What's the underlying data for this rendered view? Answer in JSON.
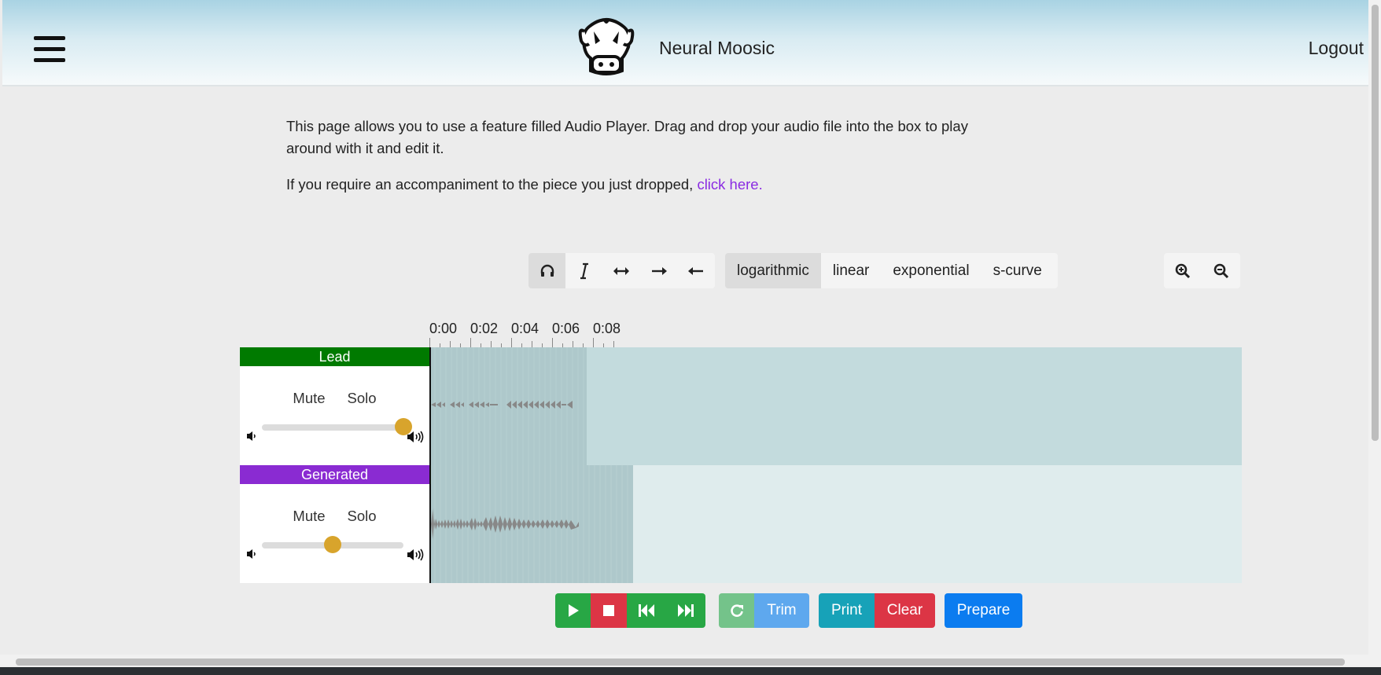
{
  "header": {
    "brand": "Neural Moosic",
    "logout": "Logout"
  },
  "intro": {
    "text": "This page allows you to use a feature filled Audio Player. Drag and drop your audio file into the box to play around with it and edit it.",
    "accompaniment_prefix": "If you require an accompaniment to the piece you just dropped, ",
    "accompaniment_link": "click here."
  },
  "toolbar": {
    "modes": [
      {
        "name": "headphones-icon",
        "active": true
      },
      {
        "name": "cursor-icon",
        "active": false
      },
      {
        "name": "shift-icon",
        "active": false
      },
      {
        "name": "fade-in-icon",
        "active": false
      },
      {
        "name": "fade-out-icon",
        "active": false
      }
    ],
    "fade_types": [
      "logarithmic",
      "linear",
      "exponential",
      "s-curve"
    ],
    "selected_fade": "logarithmic",
    "zoom": [
      "zoom-in-icon",
      "zoom-out-icon"
    ]
  },
  "timeline": {
    "labels": [
      "0:00",
      "0:02",
      "0:04",
      "0:06",
      "0:08"
    ]
  },
  "tracks": [
    {
      "name": "Lead",
      "color": "#007a00",
      "mute": "Mute",
      "solo": "Solo",
      "volume": 1.0
    },
    {
      "name": "Generated",
      "color": "#8a2bd2",
      "mute": "Mute",
      "solo": "Solo",
      "volume": 0.5
    }
  ],
  "transport": {
    "trim": "Trim",
    "print": "Print",
    "clear": "Clear",
    "prepare": "Prepare"
  }
}
